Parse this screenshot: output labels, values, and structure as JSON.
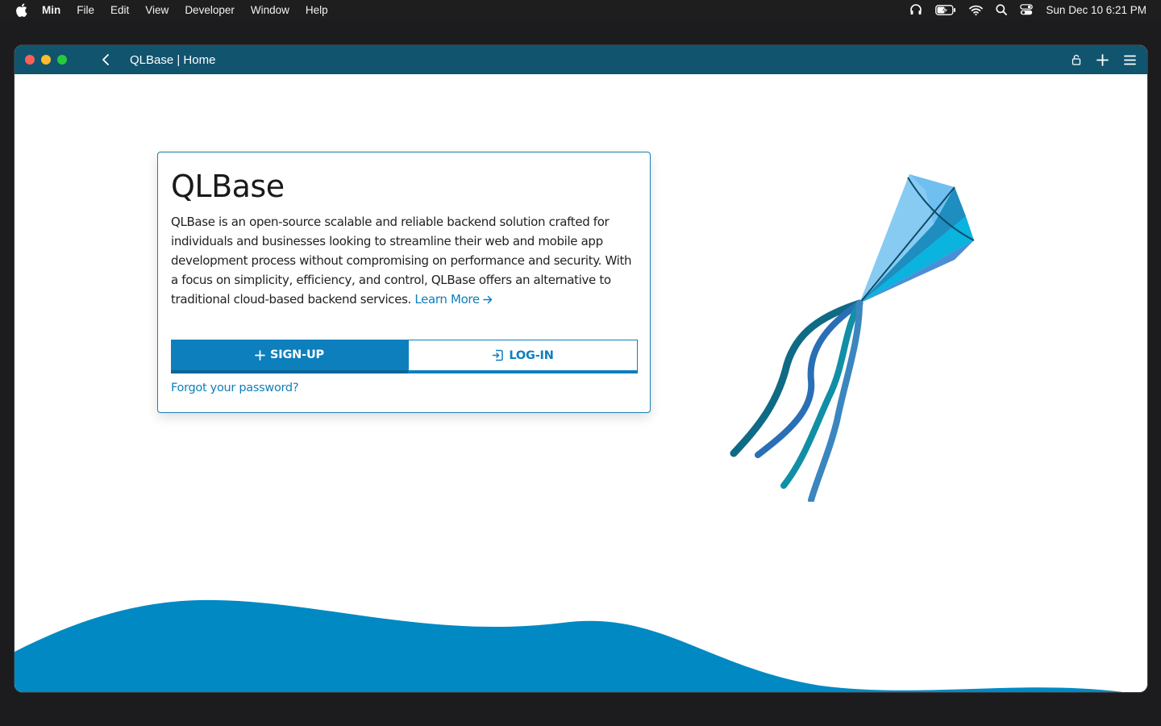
{
  "menubar": {
    "app_name": "Min",
    "items": [
      "File",
      "Edit",
      "View",
      "Developer",
      "Window",
      "Help"
    ],
    "clock": "Sun Dec 10  6:21 PM",
    "icons": [
      "apple-icon",
      "headphones-icon",
      "battery-icon",
      "wifi-icon",
      "spotlight-search-icon",
      "control-center-icon"
    ]
  },
  "window": {
    "tab_title": "QLBase | Home",
    "colors": {
      "titlebar": "#11546e",
      "accent": "#0d7fbd",
      "wave": "#0089c3"
    }
  },
  "card": {
    "title": "QLBase",
    "description": "QLBase is an open-source scalable and reliable backend solution crafted for individuals and businesses looking to streamline their web and mobile app development process without compromising on performance and security. With a focus on simplicity, efficiency, and control, QLBase offers an alternative to traditional cloud-based backend services.",
    "learn_more": "Learn More",
    "signup_label": "SIGN-UP",
    "login_label": "LOG-IN",
    "forgot_label": "Forgot your password?"
  }
}
